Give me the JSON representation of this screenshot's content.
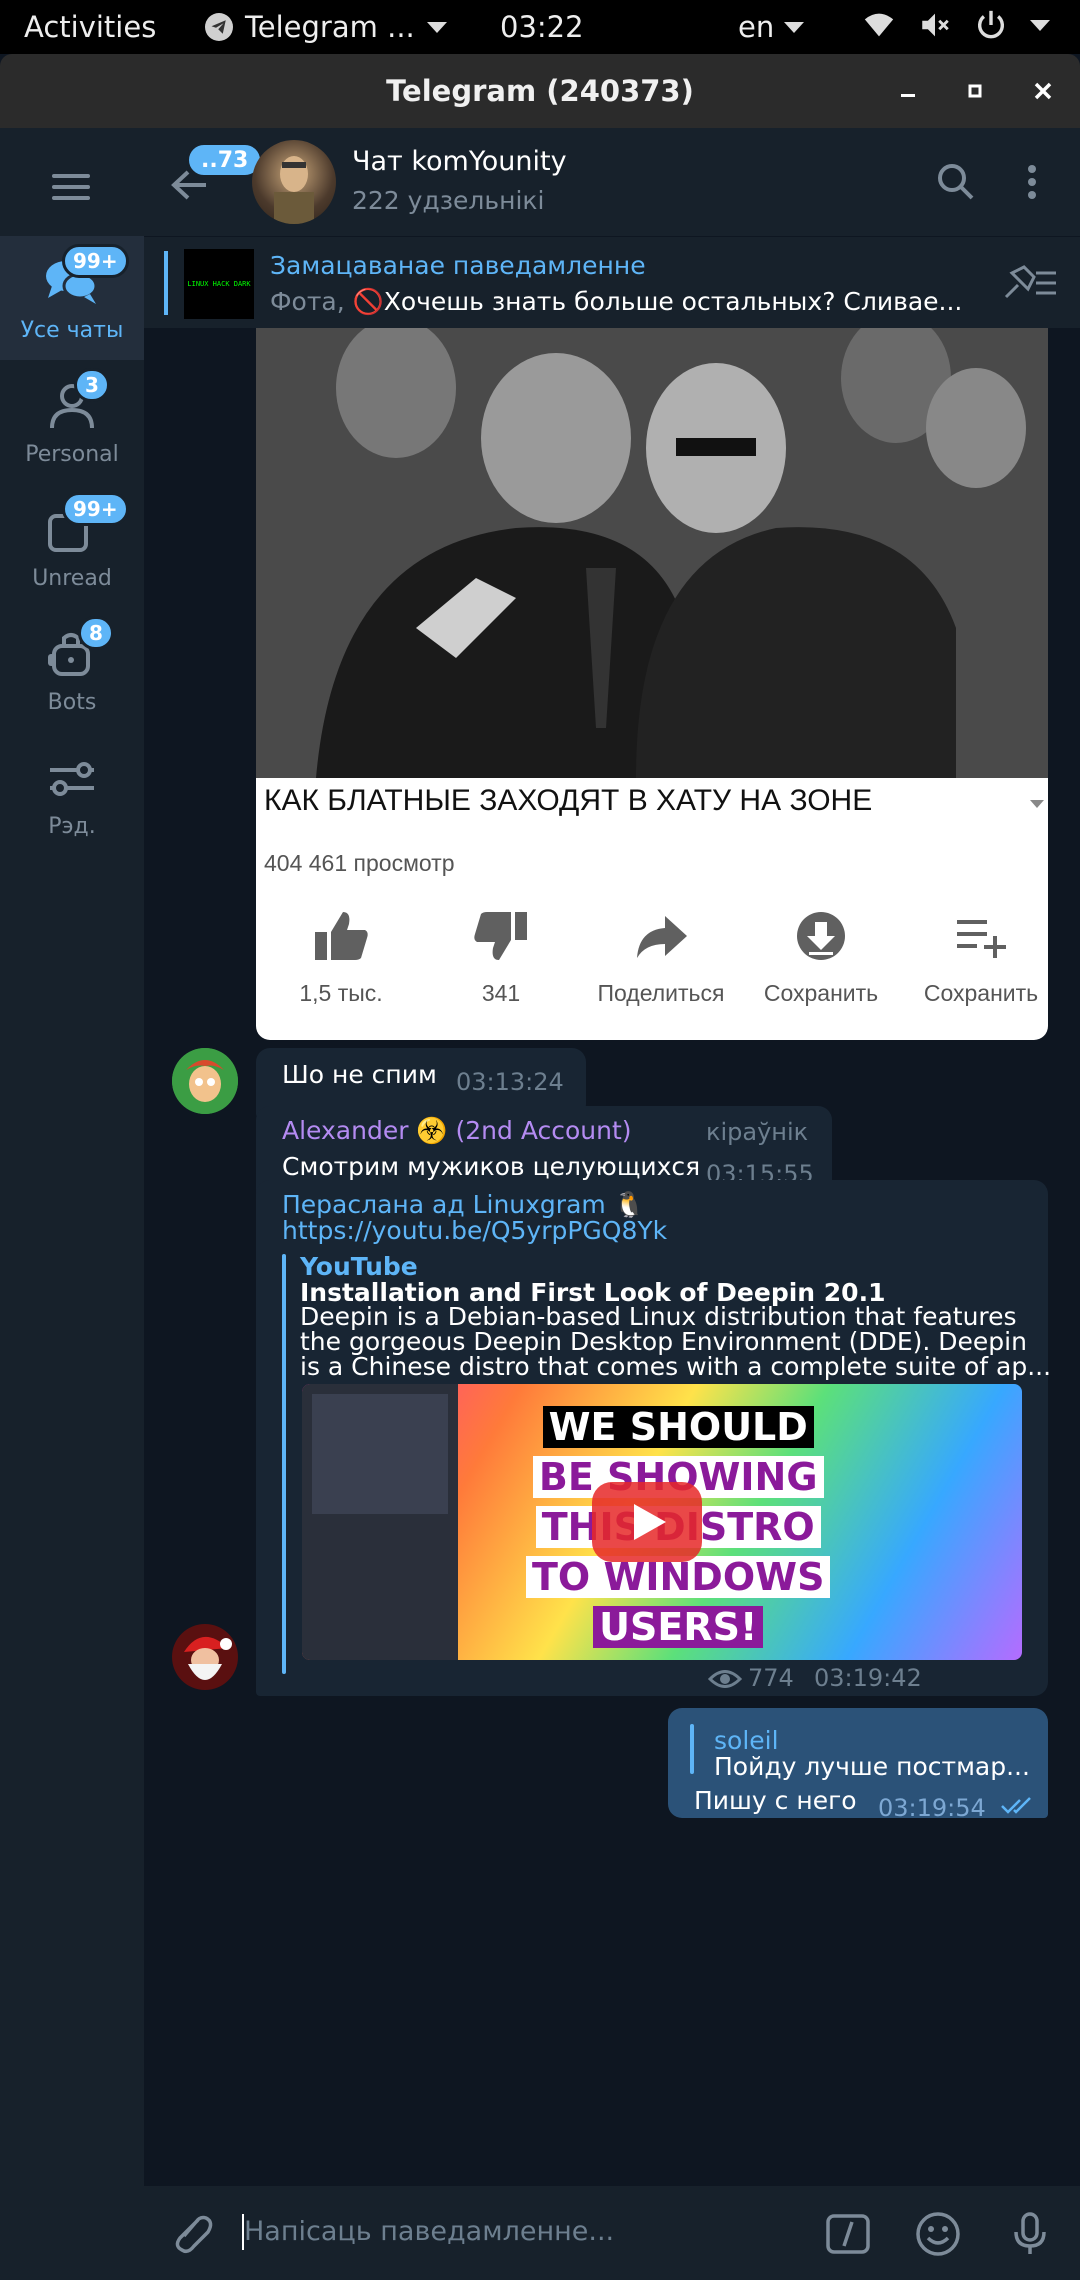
{
  "topbar": {
    "activities": "Activities",
    "app_name": "Telegram ...",
    "clock": "03:22",
    "lang": "en"
  },
  "window": {
    "title": "Telegram (240373)"
  },
  "folders": [
    {
      "label": "Усе чаты",
      "badge": "99+",
      "icon": "chats-icon",
      "active": true
    },
    {
      "label": "Personal",
      "badge": "3",
      "icon": "person-icon"
    },
    {
      "label": "Unread",
      "badge": "99+",
      "icon": "unread-icon"
    },
    {
      "label": "Bots",
      "badge": "8",
      "icon": "bot-icon"
    },
    {
      "label": "Рэд.",
      "badge": "",
      "icon": "edit-folders-icon"
    }
  ],
  "chat": {
    "back_badge": "..73",
    "title": "Чат komYounity",
    "subtitle": "222 удзельнікі"
  },
  "pinned": {
    "title": "Замацаванае паведамленне",
    "thumb_text": "LINUX HACK DARK",
    "prefix": "Фота, ",
    "text": "🚫Хочешь знать больше остальных?  Сливае..."
  },
  "image_message": {
    "caption": "КАК БЛАТНЫЕ ЗАХОДЯТ В ХАТУ НА ЗОНЕ",
    "views": "404 461 просмотр",
    "actions": [
      {
        "label": "1,5 тыс.",
        "icon": "thumbs-up-icon"
      },
      {
        "label": "341",
        "icon": "thumbs-down-icon"
      },
      {
        "label": "Поделиться",
        "icon": "share-icon"
      },
      {
        "label": "Сохранить",
        "icon": "download-icon"
      },
      {
        "label": "Сохранить",
        "icon": "playlist-add-icon"
      }
    ]
  },
  "messages": [
    {
      "text": "Шо не спим",
      "time": "03:13:24"
    },
    {
      "sender": "Alexander ☣️ (2nd Account)",
      "role": "кіраўнік",
      "text": "Смотрим мужиков целующихся",
      "time": "03:15:55"
    }
  ],
  "forward": {
    "from": "Пераслана ад Linuxgram 🐧",
    "url": "https://youtu.be/Q5yrpPGQ8Yk",
    "site": "YouTube",
    "title": "Installation and First Look of Deepin 20.1",
    "desc_line1": "Deepin is a Debian-based Linux distribution that features",
    "desc_line2": "the gorgeous Deepin Desktop Environment (DDE).  Deepin",
    "desc_line3": "is a Chinese distro that comes with a complete suite of ap...",
    "thumb_lines": [
      "WE SHOULD",
      "BE SHOWING",
      "THIS DISTRO",
      "TO WINDOWS",
      "USERS!"
    ],
    "views": "774",
    "time": "03:19:42"
  },
  "outgoing": {
    "reply_name": "soleil",
    "reply_text": "Пойду лучше постмар...",
    "text": "Пишу с него",
    "time": "03:19:54"
  },
  "composer": {
    "placeholder": "Напісаць паведамленне..."
  },
  "colors": {
    "bg": "#0e1621",
    "panel": "#17212b",
    "bubble_in": "#182533",
    "bubble_out": "#2b5278",
    "accent": "#5eb5f7",
    "sender_purple": "#b48bf2"
  }
}
